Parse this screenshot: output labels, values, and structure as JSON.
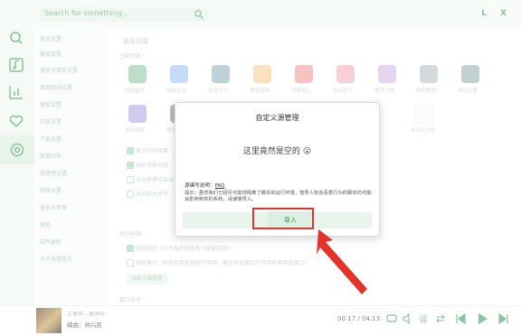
{
  "search": {
    "placeholder": "Search for something..."
  },
  "window_controls": "L X",
  "nav_icons": [
    "search-icon",
    "music-note-icon",
    "chart-icon",
    "heart-icon",
    "settings-icon"
  ],
  "sidebar": {
    "items": [
      "基本设置",
      "播放设置",
      "播放详情页设置",
      "桌面歌词设置",
      "搜索设置",
      "列表设置",
      "下载设置",
      "数据同步",
      "快捷键设置",
      "网络设置",
      "备份与恢复",
      "其他",
      "软件更新",
      "关于洛雪音乐"
    ]
  },
  "main": {
    "section_title": "基本设置",
    "theme_label": "主题颜色",
    "themes_row1": [
      "绿意盎然",
      "蓝田生玉",
      "信宜之上",
      "橙黄橘绿",
      "热情似火",
      "粉红佳人",
      "重庆火锅",
      "热浪美团",
      "青出于蓝"
    ],
    "themes_row2": [
      "清热解毒",
      "黑色"
    ],
    "custom_theme": "自定义主题",
    "options": [
      "显示动画效果",
      "随机背景动效",
      "以全屏模式启动",
      "关闭软件时不..."
    ],
    "source_label": "音乐来源",
    "source_options": [
      "测试接口（几乎软件的所有功能都可用）",
      "临时接口（软件的某些功能不可用，建议测试接口不可用再使用本接口）"
    ],
    "custom_source_btn": "自定义源管理",
    "window_size_label": "窗口尺寸"
  },
  "modal": {
    "title": "自定义源管理",
    "empty_text": "这里竟然是空的 😮",
    "help_prefix": "源编写说明：",
    "help_link": "FAQ",
    "hint": "提示：虽然我们已经尽可能地隔离了脚本的运行环境，但导入包含恶意行为的脚本仍可能会影响到你的系统，请谨慎导入。",
    "import_button": "导入"
  },
  "player": {
    "song": "三季声 - 萧声吟",
    "singer": "编曲：钟兴民",
    "time": "00:17 / 04:13"
  },
  "colors": {
    "accent": "#2e9b52",
    "highlight": "#e5332a"
  }
}
